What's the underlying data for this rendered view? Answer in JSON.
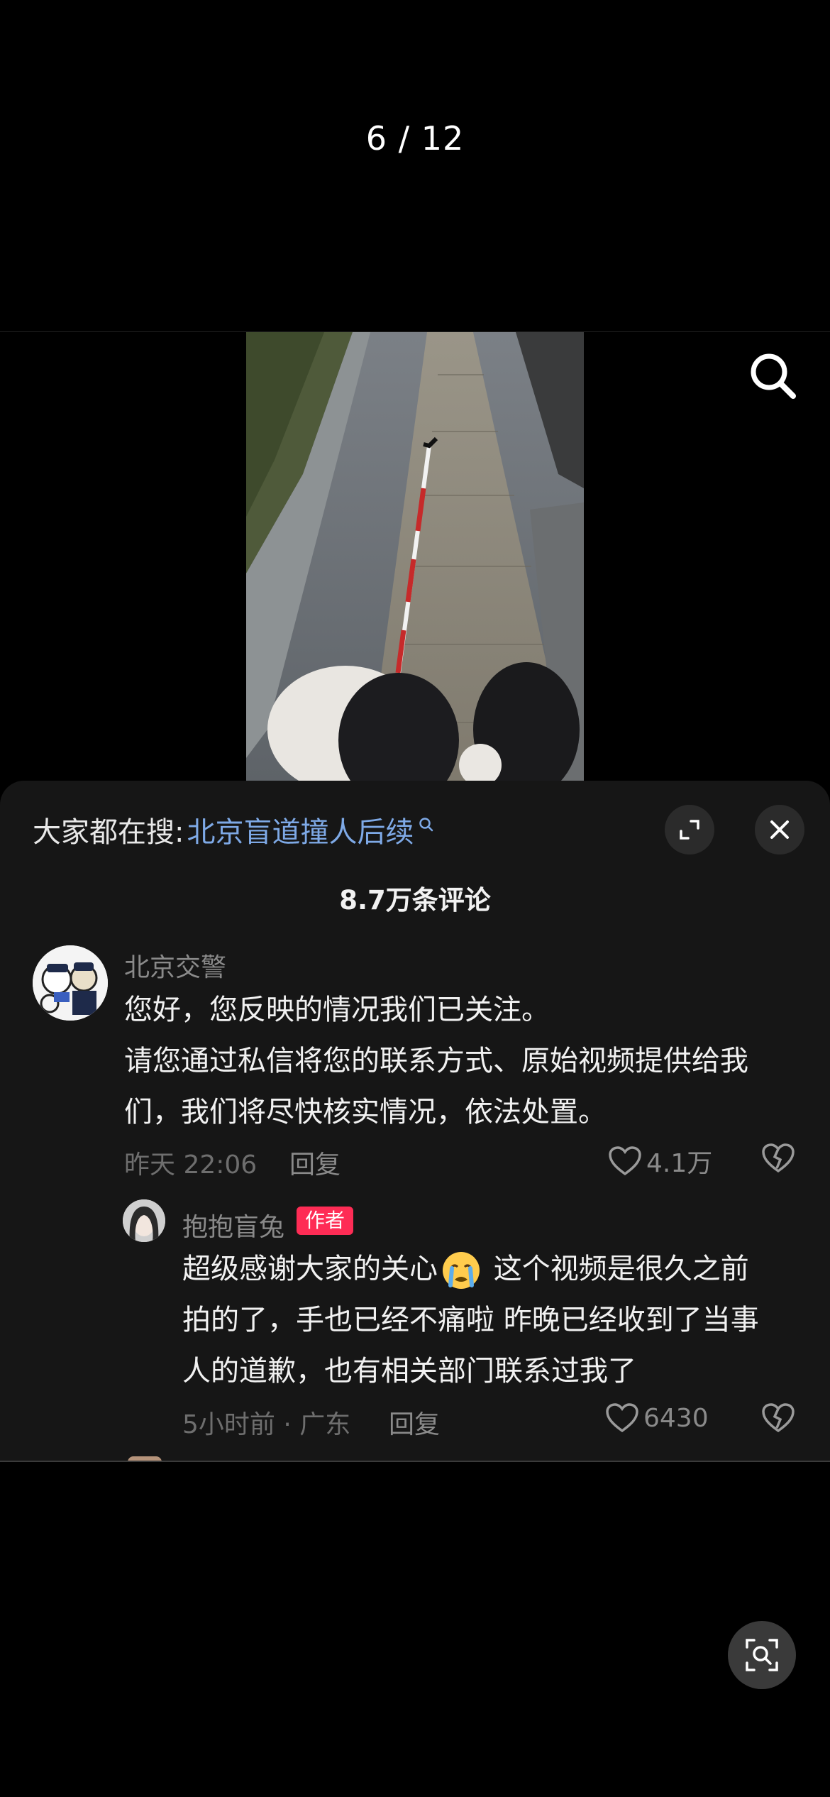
{
  "viewer": {
    "page_counter": "6 / 12"
  },
  "comments_panel": {
    "hot_search_label": "大家都在搜:",
    "hot_search_keyword": "北京盲道撞人后续",
    "comment_count": "8.7万条评论",
    "comments": [
      {
        "username": "北京交警",
        "lines": [
          "您好，您反映的情况我们已关注。",
          "请您通过私信将您的联系方式、原始视频提供给我",
          "们，我们将尽快核实情况，依法处置。"
        ],
        "time": "昨天 22:06",
        "reply_label": "回复",
        "likes": "4.1万"
      }
    ],
    "reply": {
      "username": "抱抱盲兔",
      "badge": "作者",
      "line1_a": "超级感谢大家的关心",
      "line1_b": " 这个视频是很久之前",
      "line2": "拍的了，手也已经不痛啦 昨晚已经收到了当事",
      "line3": "人的道歉，也有相关部门联系过我了",
      "time_location": "5小时前 · 广东",
      "reply_label": "回复",
      "likes": "6430"
    }
  },
  "icons": {
    "search": "search-icon",
    "expand": "expand-icon",
    "close": "close-icon",
    "heart": "heart-icon",
    "broken_heart": "broken-heart-icon",
    "lens": "lens-search-icon",
    "crying_emoji": "crying-face-emoji"
  },
  "colors": {
    "accent_link": "#7ea9e6",
    "badge": "#fe2c55",
    "panel_bg": "#161616"
  }
}
